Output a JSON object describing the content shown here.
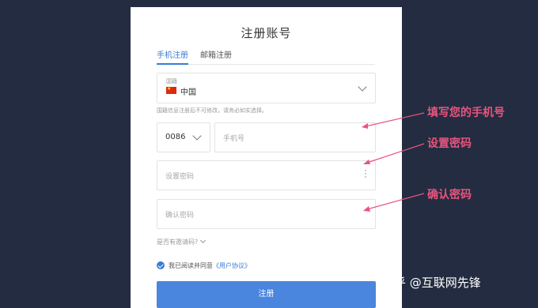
{
  "form": {
    "title": "注册账号",
    "tabs": [
      {
        "label": "手机注册",
        "active": true
      },
      {
        "label": "邮箱注册",
        "active": false
      }
    ],
    "country": {
      "caption": "国籍",
      "value": "中国"
    },
    "country_hint": "国籍信息注册后不可修改，请务必如实选择。",
    "country_code": "0086",
    "phone_placeholder": "手机号",
    "password_placeholder": "设置密码",
    "confirm_placeholder": "确认密码",
    "invite_label": "是否有邀请码?",
    "agreement": {
      "prefix": "我已阅读并同意",
      "link": "《用户协议》",
      "checked": true
    },
    "submit_label": "注册"
  },
  "annotations": {
    "phone": "填写您的手机号",
    "password": "设置密码",
    "confirm": "确认密码"
  },
  "watermark": "知乎 @互联网先锋",
  "colors": {
    "background": "#232c40",
    "accent": "#3b7bd6",
    "button": "#4a85de",
    "annotation": "#e9547e"
  }
}
